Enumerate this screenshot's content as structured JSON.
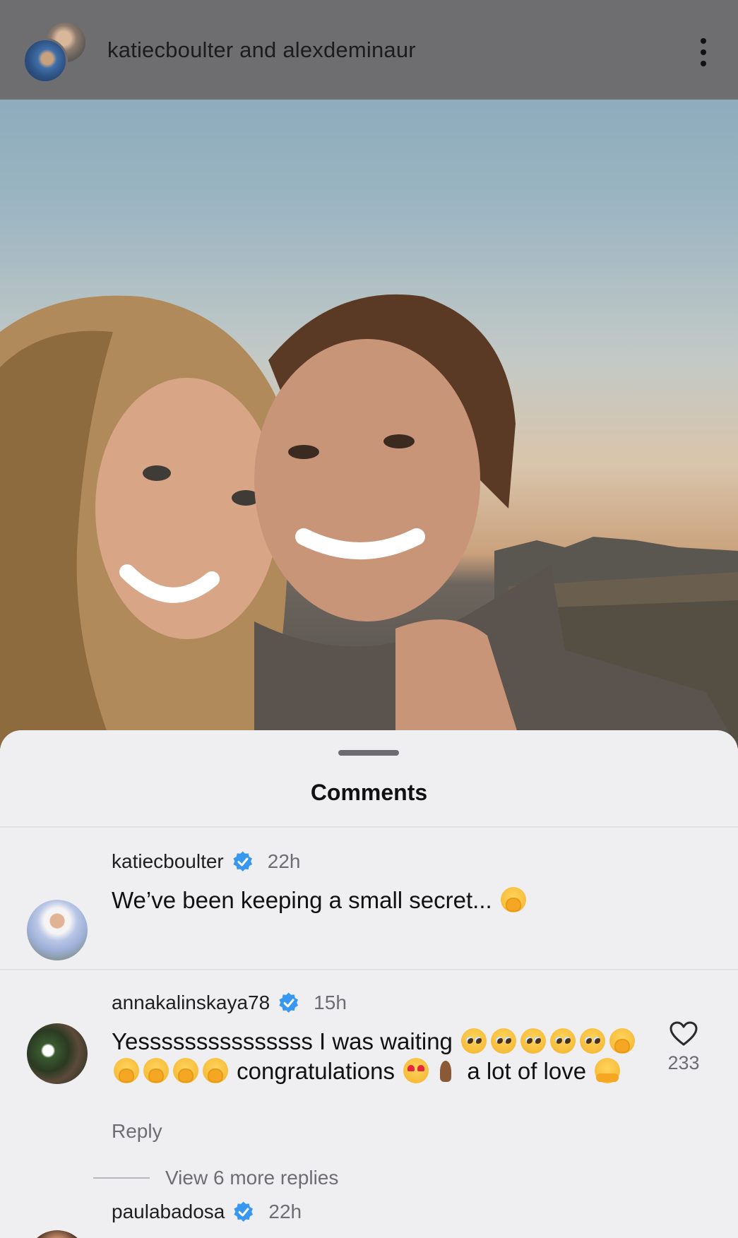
{
  "header": {
    "title": "katiecboulter and alexdeminaur"
  },
  "comments_sheet": {
    "title": "Comments",
    "comments": [
      {
        "username": "katiecboulter",
        "time": "22h",
        "text": "We’ve been keeping a small secret... ",
        "emoji": "hand-over-mouth"
      },
      {
        "username": "annakalinskaya78",
        "time": "15h",
        "text_part1": "Yesssssssssssssss I was waiting ",
        "text_part2": " congratulations ",
        "text_part3": " a lot of love ",
        "reply_label": "Reply",
        "like_count": "233",
        "view_replies": "View 6 more replies"
      },
      {
        "username": "paulabadosa",
        "time": "22h"
      }
    ]
  },
  "colors": {
    "verified": "#3897f0",
    "sheet_bg": "#efeff1",
    "top_bar": "#6e6e70"
  }
}
